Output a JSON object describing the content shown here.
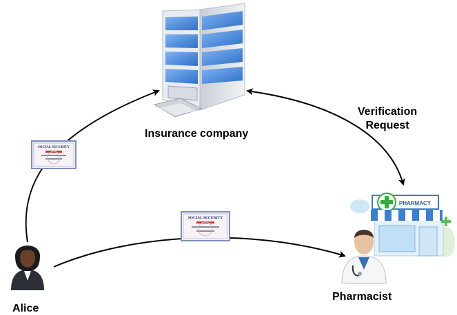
{
  "labels": {
    "insurance_company": "Insurance company",
    "verification_line1": "Verification",
    "verification_line2": "Request",
    "alice": "Alice",
    "pharmacist": "Pharmacist"
  },
  "card": {
    "header": "SOCIAL SECURITY"
  },
  "pharmacy": {
    "sign": "PHARMACY"
  },
  "colors": {
    "building_glass": "#4a8fe0",
    "building_frame": "#e6e9ee",
    "pharmacy_awning": "#3a7fd0",
    "pharmacy_cross": "#2fae3a",
    "card_border": "#7f8fb8",
    "arrow": "#000000"
  }
}
